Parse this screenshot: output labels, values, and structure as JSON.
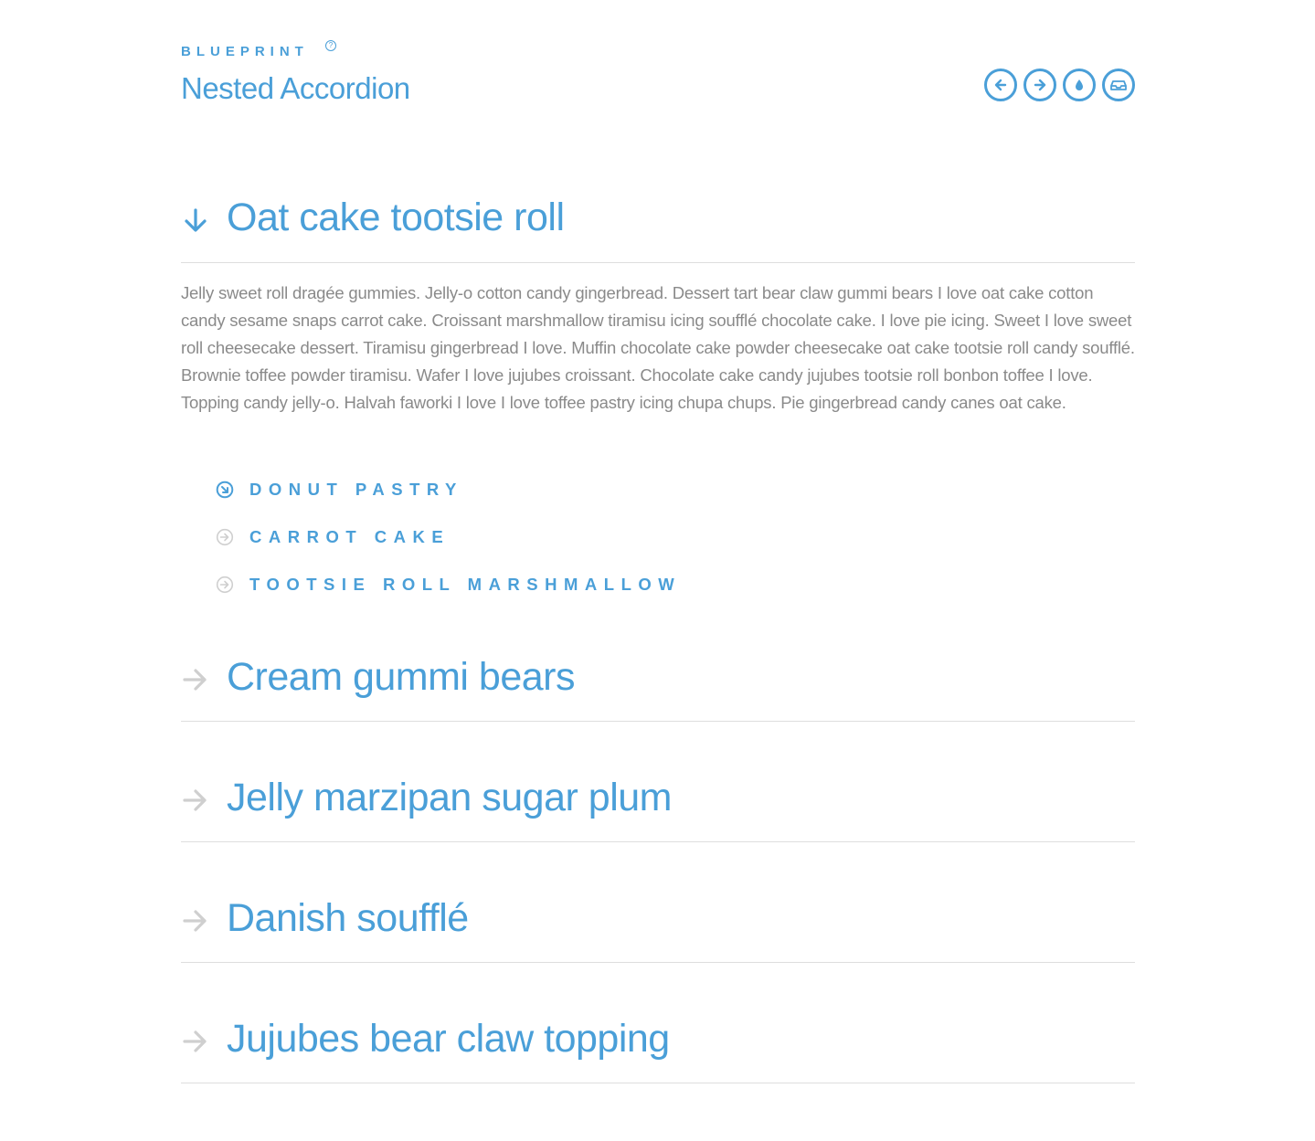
{
  "header": {
    "brand": "BLUEPRINT",
    "brand_mark": "?",
    "title": "Nested Accordion",
    "nav": [
      {
        "icon": "arrow-left-icon"
      },
      {
        "icon": "arrow-right-icon"
      },
      {
        "icon": "drop-icon"
      },
      {
        "icon": "inbox-icon"
      }
    ]
  },
  "colors": {
    "accent": "#4a9fd8",
    "muted_arrow": "#cfcfcf",
    "body_text": "#8a8a8a",
    "divider": "#dedede"
  },
  "accordion": {
    "sections": [
      {
        "title": "Oat cake tootsie roll",
        "expanded": true,
        "body": "Jelly sweet roll dragée gummies. Jelly-o cotton candy gingerbread. Dessert tart bear claw gummi bears I love oat cake cotton candy sesame snaps carrot cake. Croissant marshmallow tiramisu icing soufflé chocolate cake. I love pie icing. Sweet I love sweet roll cheesecake dessert. Tiramisu gingerbread I love. Muffin chocolate cake powder cheesecake oat cake tootsie roll candy soufflé. Brownie toffee powder tiramisu. Wafer I love jujubes croissant. Chocolate cake candy jujubes tootsie roll bonbon toffee I love. Topping candy jelly-o. Halvah faworki I love I love toffee pastry icing chupa chups. Pie gingerbread candy canes oat cake.",
        "sub_items": [
          {
            "label": "DONUT PASTRY",
            "active": true
          },
          {
            "label": "CARROT CAKE",
            "active": false
          },
          {
            "label": "TOOTSIE ROLL MARSHMALLOW",
            "active": false
          }
        ]
      },
      {
        "title": "Cream gummi bears",
        "expanded": false
      },
      {
        "title": "Jelly marzipan sugar plum",
        "expanded": false
      },
      {
        "title": "Danish soufflé",
        "expanded": false
      },
      {
        "title": "Jujubes bear claw topping",
        "expanded": false
      }
    ]
  }
}
